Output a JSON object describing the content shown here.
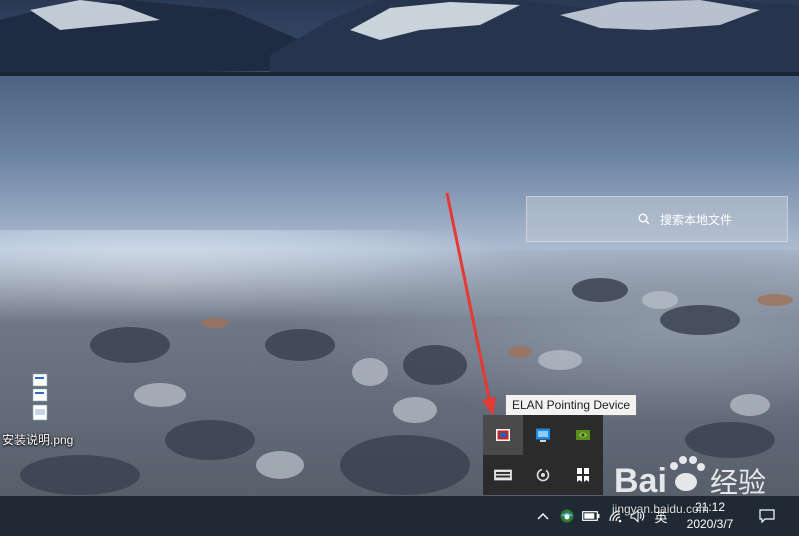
{
  "desktop": {
    "search_label": "搜索本地文件",
    "file_label": "安装说明.png"
  },
  "tooltip": {
    "text": "ELAN Pointing Device"
  },
  "tray": {
    "flyout_icons": [
      "elan-pointing-icon",
      "intel-graphics-icon",
      "nvidia-icon",
      "keyboard-icon",
      "sync-icon",
      "bookmark-icon"
    ]
  },
  "taskbar": {
    "ime": "英",
    "time": "21:12",
    "date": "2020/3/7"
  },
  "watermark": {
    "logo_text": "Bai",
    "brand_suffix": "经验",
    "url": "jingyan.baidu.com"
  },
  "colors": {
    "taskbar": "#1f2a34",
    "arrow": "#e53935",
    "tooltip_bg": "#f2f2f2"
  }
}
